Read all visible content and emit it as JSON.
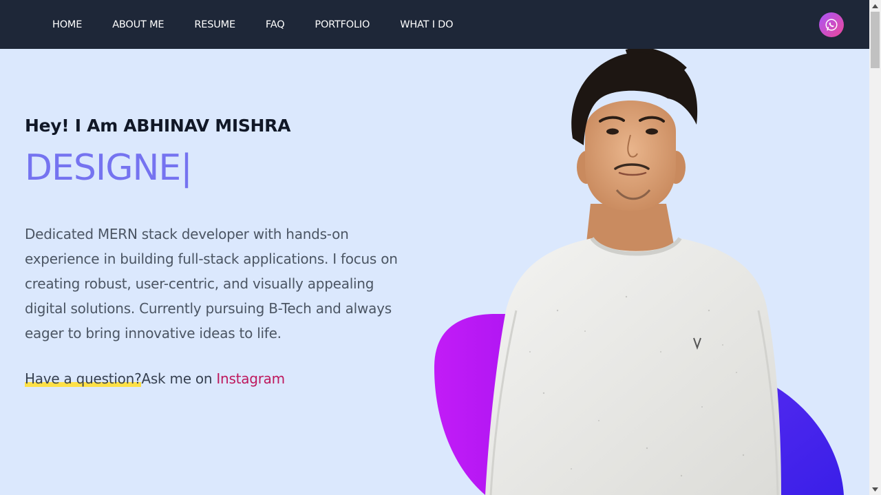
{
  "nav": {
    "links": [
      "HOME",
      "ABOUT ME",
      "RESUME",
      "FAQ",
      "PORTFOLIO",
      "WHAT I DO"
    ],
    "whatsapp_icon": "whatsapp-icon"
  },
  "hero": {
    "greeting": "Hey! I Am ABHINAV MISHRA",
    "role_typed": "DESIGNE",
    "caret": "|",
    "description": "Dedicated MERN stack developer with hands-on experience in building full-stack applications. I focus on creating robust, user-centric, and visually appealing digital solutions. Currently pursuing B-Tech and always eager to bring innovative ideas to life.",
    "question_highlight": "Have a question?",
    "question_rest": "Ask me on ",
    "instagram_link": "Instagram"
  },
  "colors": {
    "nav_bg": "#1e2738",
    "page_bg": "#dbe8fd",
    "accent": "#7573f0",
    "link": "#be185d",
    "highlight": "#fde047",
    "blob_purple": "#b918f5",
    "blob_blue": "#3b1ff0"
  }
}
